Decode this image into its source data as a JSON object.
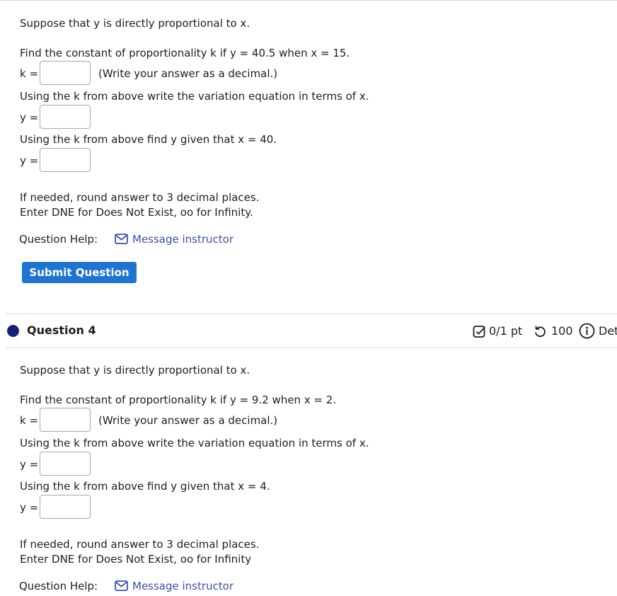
{
  "q3": {
    "intro": "Suppose that y is directly proportional to x.",
    "find_k": "Find the constant of proportionality k if y = 40.5 when x = 15.",
    "k_label": "k =",
    "k_hint": "(Write your answer as a decimal.)",
    "eq_prompt": "Using the k from above write the variation equation in terms of x.",
    "y_label1": "y =",
    "find_y": "Using the k from above find y given that x = 40.",
    "y_label2": "y =",
    "round_note": "If needed, round answer to 3 decimal places.",
    "dne_note": "Enter DNE for Does Not Exist, oo for Infinity.",
    "help_label": "Question Help:",
    "help_link": "Message instructor",
    "submit_label": "Submit Question"
  },
  "q4": {
    "title": "Question 4",
    "score": "0/1 pt",
    "attempts": "100",
    "details": "Det",
    "intro": "Suppose that y is directly proportional to x.",
    "find_k": "Find the constant of proportionality k if y = 9.2 when x = 2.",
    "k_label": "k =",
    "k_hint": "(Write your answer as a decimal.)",
    "eq_prompt": "Using the k from above write the variation equation in terms of x.",
    "y_label1": "y =",
    "find_y": "Using the k from above find y given that x = 4.",
    "y_label2": "y =",
    "round_note": "If needed, round answer to 3 decimal places.",
    "dne_note": "Enter DNE for Does Not Exist, oo for Infinity",
    "help_label": "Question Help:",
    "help_link": "Message instructor"
  },
  "colors": {
    "link": "#3a4eb3",
    "button": "#1f74d2",
    "dot": "#17207a"
  },
  "icons": [
    "mail-icon",
    "check-square-icon",
    "retry-icon",
    "info-icon"
  ]
}
